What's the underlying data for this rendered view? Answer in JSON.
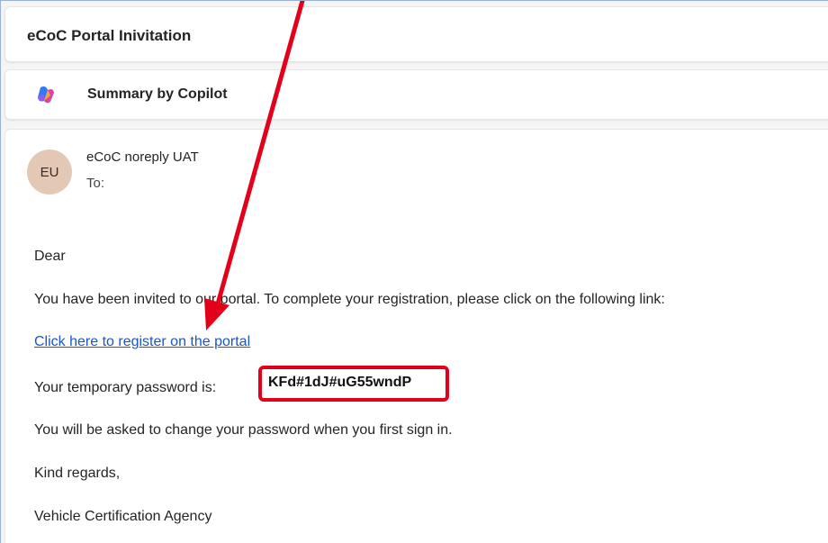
{
  "header": {
    "subject": "eCoC Portal Inivitation"
  },
  "copilot": {
    "label": "Summary by Copilot",
    "icon": "copilot-icon"
  },
  "message": {
    "avatar_initials": "EU",
    "avatar_color": "#e3c9b5",
    "sender": "eCoC noreply UAT",
    "to_label": "To:",
    "greeting": "Dear",
    "intro": "You have been invited to our portal. To complete your registration, please click on the following link:",
    "register_link": "Click here to register on the portal",
    "password_label": "Your temporary password is:",
    "password": "KFd#1dJ#uG55wndP",
    "change_notice": "You will be asked to change your password when you first sign in.",
    "closing": "Kind regards,",
    "signature": "Vehicle Certification Agency"
  },
  "annotation": {
    "color": "#e3001b"
  },
  "colors": {
    "link": "#1a55c9",
    "highlight": "#e3001b"
  }
}
